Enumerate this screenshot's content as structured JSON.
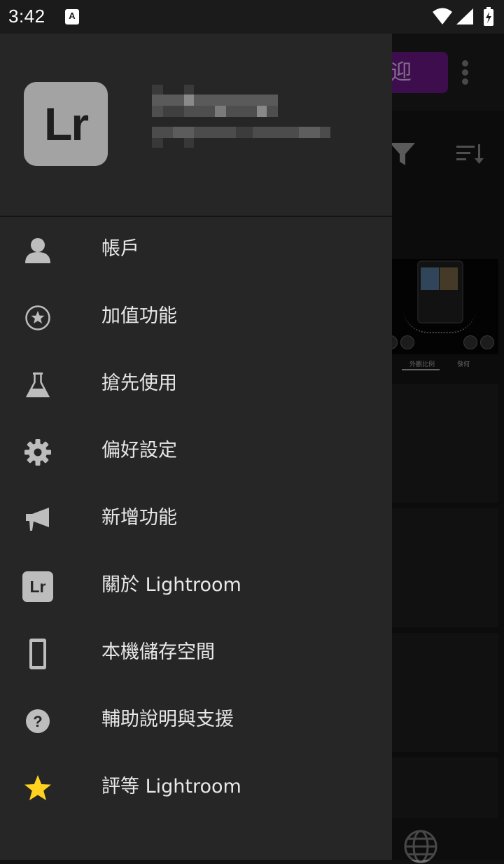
{
  "status_bar": {
    "time": "3:42",
    "notification_icon": "accessibility-a-icon",
    "icons": [
      "wifi-icon",
      "cell-signal-icon",
      "battery-charging-icon"
    ]
  },
  "drawer": {
    "app_logo_text": "Lr",
    "profile_name": "",
    "profile_email": "",
    "menu_items": [
      {
        "label": "帳戶",
        "icon": "account-person-icon"
      },
      {
        "label": "加值功能",
        "icon": "star-circle-icon"
      },
      {
        "label": "搶先使用",
        "icon": "flask-icon"
      },
      {
        "label": "偏好設定",
        "icon": "gear-icon"
      },
      {
        "label": "新增功能",
        "icon": "megaphone-icon"
      },
      {
        "label": "關於 Lightroom",
        "icon": "lightroom-logo-icon"
      },
      {
        "label": "本機儲存空間",
        "icon": "phone-storage-icon"
      },
      {
        "label": "輔助說明與支援",
        "icon": "help-circle-icon"
      },
      {
        "label": "評等 Lightroom",
        "icon": "star-icon"
      }
    ]
  },
  "background": {
    "welcome_button_text": "迎",
    "tab_labels": [
      "外觀比例",
      "發何"
    ]
  },
  "colors": {
    "drawer_bg": "#262626",
    "logo_bg": "#a3a3a3",
    "star_yellow": "#ffd21f",
    "welcome_purple": "#5e1479"
  }
}
